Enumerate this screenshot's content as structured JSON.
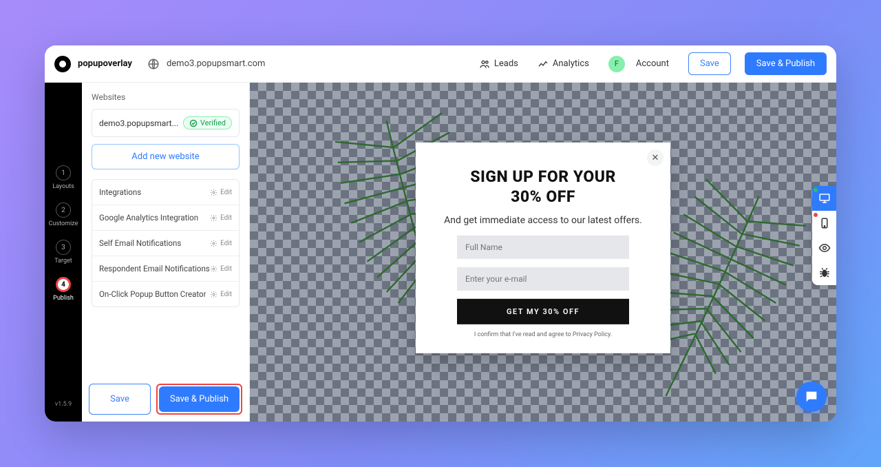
{
  "header": {
    "app_title": "popupoverlay",
    "domain": "demo3.popupsmart.com",
    "leads": "Leads",
    "analytics": "Analytics",
    "account": "Account",
    "avatar_letter": "F",
    "save": "Save",
    "save_publish": "Save & Publish"
  },
  "rail": {
    "steps": [
      {
        "num": "1",
        "label": "Layouts"
      },
      {
        "num": "2",
        "label": "Customize"
      },
      {
        "num": "3",
        "label": "Target"
      },
      {
        "num": "4",
        "label": "Publish"
      }
    ],
    "version": "v1.5.9"
  },
  "panel": {
    "websites_label": "Websites",
    "website_name": "demo3.popupsmart...",
    "verified": "Verified",
    "add_website": "Add new website",
    "settings": [
      "Integrations",
      "Google Analytics Integration",
      "Self Email Notifications",
      "Respondent Email Notifications",
      "On-Click Popup Button Creator"
    ],
    "edit": "Edit",
    "footer_save": "Save",
    "footer_publish": "Save & Publish"
  },
  "popup": {
    "title_line1": "SIGN UP FOR YOUR",
    "title_line2": "30% OFF",
    "subtitle": "And get immediate access to our latest offers.",
    "fullname_placeholder": "Full Name",
    "email_placeholder": "Enter your e-mail",
    "cta": "GET MY 30% OFF",
    "privacy": "I confirm that I've read and agree to Privacy Policy."
  }
}
